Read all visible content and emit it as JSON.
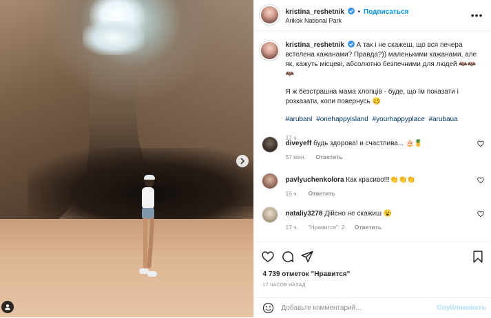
{
  "header": {
    "username": "kristina_reshetnik",
    "separator": "•",
    "follow_label": "Подписаться",
    "location": "Arikok National Park",
    "more_label": "•••"
  },
  "caption": {
    "username": "kristina_reshetnik",
    "text1": "А так і не скажеш, що вся печера встелена кажанами? Правда?)) маленькими кажанами, але як, кажуть місцеві, абсолютно безпечними для людей 🦇🦇🦇",
    "text2": "Я ж безстрашна мама хлопців - буде, що їм показати і розказати, коли повернусь 🥴",
    "hashtags": [
      "#arubanl",
      "#onehappyisland",
      "#yourhappyplace",
      "#arubaua"
    ],
    "time": "17 ч."
  },
  "comments": [
    {
      "username": "diveyeff",
      "text": "будь здорова! и счастлива... 🎂🍍",
      "time": "57 мин.",
      "likes": "",
      "reply_label": "Ответить"
    },
    {
      "username": "pavlyuchenkolora",
      "text": "Как красиво!!!👏👏👏",
      "time": "16 ч.",
      "likes": "",
      "reply_label": "Ответить"
    },
    {
      "username": "nataliy3278",
      "text": "Дійсно не скажиш 😮",
      "time": "17 ч.",
      "likes": "\"Нравится\": 2",
      "reply_label": "Ответить"
    }
  ],
  "likes_text": "4 739 отметок \"Нравится\"",
  "posted_ago": "17 ЧАСОВ НАЗАД",
  "add_comment": {
    "placeholder": "Добавьте комментарий...",
    "publish_label": "Опубликовать"
  },
  "colors": {
    "link": "#0095f6",
    "hashtag": "#00376b",
    "muted": "#8e8e8e",
    "publish_disabled": "#b2dffc"
  },
  "icons": [
    "carousel-next-icon",
    "tag-user-icon",
    "verified-icon",
    "more-options-icon",
    "like-icon",
    "comment-icon",
    "share-icon",
    "save-bookmark-icon",
    "emoji-icon",
    "comment-like-icon"
  ]
}
